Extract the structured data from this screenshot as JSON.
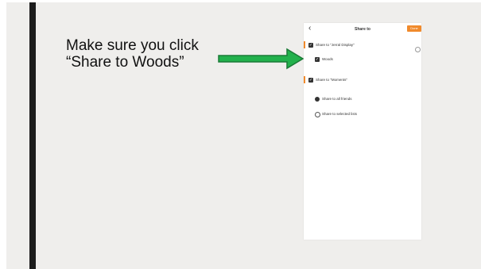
{
  "instruction": {
    "line1": "Make sure you click",
    "line2": "“Share to Woods”"
  },
  "phone": {
    "title": "Share to",
    "back_icon": "chevron-left-icon",
    "done_label": "Done",
    "options": [
      {
        "label": "Share to \"Jerral Display\"",
        "checked": true
      },
      {
        "label": "Woods",
        "checked": true
      },
      {
        "label": "Share to \"Moments\"",
        "checked": true
      },
      {
        "label": "Share to all friends",
        "selected": true
      },
      {
        "label": "Share to selected lists",
        "selected": false
      }
    ]
  },
  "colors": {
    "accent_bar": "#1c1c1c",
    "arrow": "#22b14c",
    "done": "#f08a2c",
    "background": "#efeeec"
  }
}
